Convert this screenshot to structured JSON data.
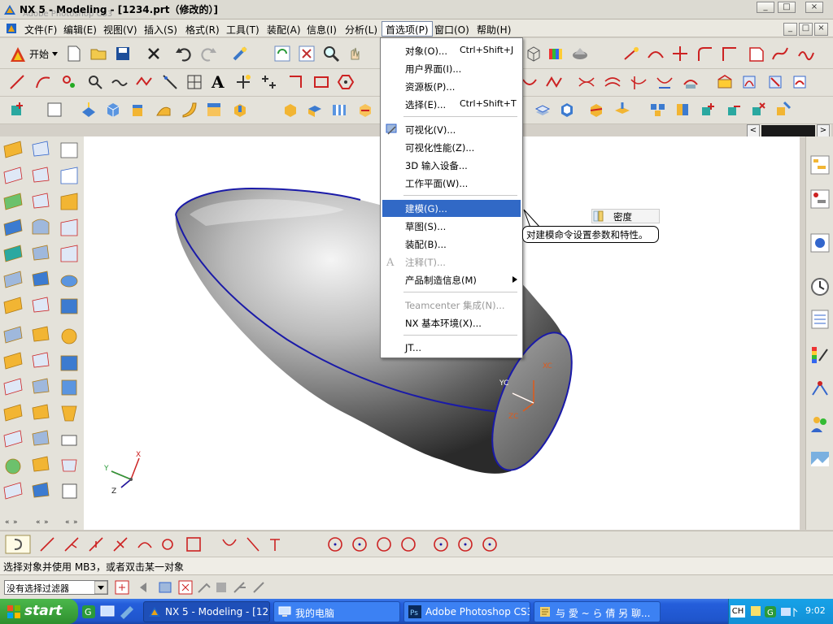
{
  "window": {
    "title": "NX 5 - Modeling - [1234.prt（修改的）]",
    "ghost_title": "Adobe Photoshop CS3",
    "buttons": [
      "_",
      "□",
      "×"
    ]
  },
  "menubar": {
    "items": [
      "文件(F)",
      "编辑(E)",
      "视图(V)",
      "插入(S)",
      "格式(R)",
      "工具(T)",
      "装配(A)",
      "信息(I)",
      "分析(L)",
      "首选项(P)",
      "窗口(O)",
      "帮助(H)"
    ],
    "active_index": 9
  },
  "toolbar": {
    "start_label": "开始"
  },
  "dropdown": {
    "items": [
      {
        "label": "对象(O)...",
        "shortcut": "Ctrl+Shift+J"
      },
      {
        "label": "用户界面(I)..."
      },
      {
        "label": "资源板(P)..."
      },
      {
        "label": "选择(E)...",
        "shortcut": "Ctrl+Shift+T"
      },
      {
        "label": "可视化(V)..."
      },
      {
        "label": "可视化性能(Z)..."
      },
      {
        "label": "3D 输入设备..."
      },
      {
        "label": "工作平面(W)..."
      },
      {
        "label": "建模(G)...",
        "selected": true
      },
      {
        "label": "草图(S)..."
      },
      {
        "label": "装配(B)..."
      },
      {
        "label": "注释(T)...",
        "disabled": true
      },
      {
        "label": "产品制造信息(M)",
        "submenu": true
      },
      {
        "label": "Teamcenter 集成(N)...",
        "disabled": true
      },
      {
        "label": "NX 基本环境(X)..."
      },
      {
        "label": "JT..."
      }
    ]
  },
  "tooltip": {
    "text": "对建模命令设置参数和特性。"
  },
  "density_label": "密度",
  "viewport": {
    "triad_labels": {
      "x": "X",
      "y": "Y",
      "z": "Z"
    },
    "wcs_labels": {
      "xc": "XC",
      "yc": "YC",
      "zc": "ZC"
    }
  },
  "status": {
    "text": "选择对象并使用 MB3，或者双击某一对象"
  },
  "filter": {
    "value": "没有选择过滤器"
  },
  "taskbar": {
    "start": "start",
    "tasks": [
      "NX 5 - Modeling - [12...",
      "我的电脑",
      "Adobe Photoshop CS3",
      "与 愛 ~ ら 倩 另 聊..."
    ],
    "ime": "CH",
    "clock": "9:02"
  }
}
